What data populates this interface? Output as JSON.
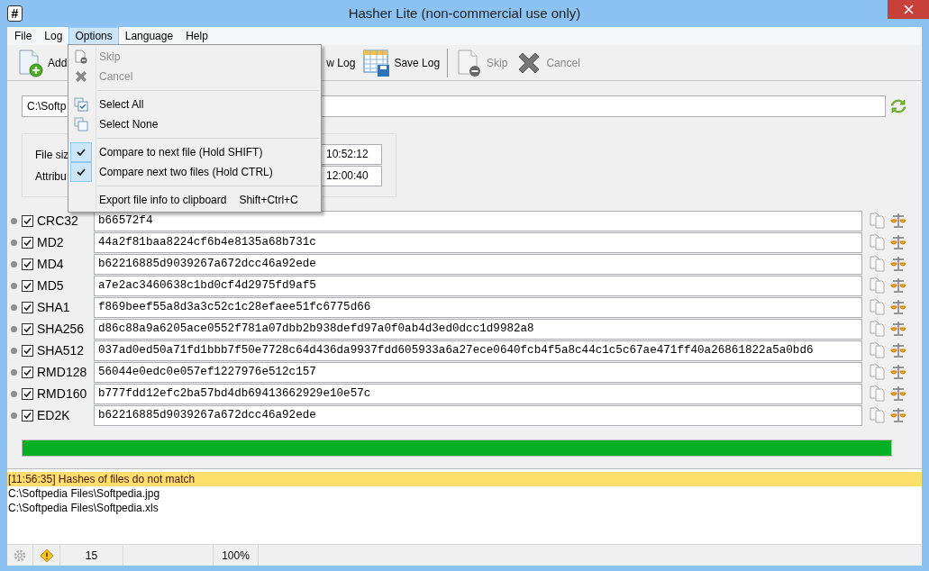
{
  "window": {
    "app_icon": "#",
    "title": "Hasher Lite (non-commercial use only)"
  },
  "menu_bar": [
    {
      "label": "File",
      "selected": false
    },
    {
      "label": "Log",
      "selected": false
    },
    {
      "label": "Options",
      "selected": true
    },
    {
      "label": "Language",
      "selected": false
    },
    {
      "label": "Help",
      "selected": false
    }
  ],
  "toolbar": [
    {
      "kind": "add",
      "label": "Add",
      "disabled": false
    },
    {
      "kind": "view",
      "label": "w Log",
      "disabled": false
    },
    {
      "kind": "save",
      "label": "Save Log",
      "disabled": false
    },
    {
      "kind": "sep"
    },
    {
      "kind": "skip",
      "label": "Skip",
      "disabled": true
    },
    {
      "kind": "cancel",
      "label": "Cancel",
      "disabled": true
    }
  ],
  "options_menu": [
    {
      "kind": "skip",
      "label": "Skip",
      "disabled": true
    },
    {
      "kind": "cancel",
      "label": "Cancel",
      "disabled": true
    },
    {
      "kind": "sep"
    },
    {
      "kind": "selall",
      "label": "Select All",
      "disabled": false
    },
    {
      "kind": "selnone",
      "label": "Select None",
      "disabled": false
    },
    {
      "kind": "sep"
    },
    {
      "kind": "check",
      "label": "Compare to next file (Hold SHIFT)",
      "checked": true,
      "disabled": false
    },
    {
      "kind": "check",
      "label": "Compare next two files (Hold CTRL)",
      "checked": true,
      "disabled": false
    },
    {
      "kind": "sep"
    },
    {
      "kind": "plain",
      "label": "Export file info to clipboard",
      "shortcut": "Shift+Ctrl+C",
      "disabled": false
    }
  ],
  "path_field": {
    "value": "C:\\Softp"
  },
  "file_info": [
    {
      "label": "File siz",
      "value": "10:52:12"
    },
    {
      "label": "Attribu",
      "value": "12:00:40"
    }
  ],
  "hashes": [
    {
      "name": "CRC32",
      "checked": true,
      "value": "b66572f4"
    },
    {
      "name": "MD2",
      "checked": true,
      "value": "44a2f81baa8224cf6b4e8135a68b731c"
    },
    {
      "name": "MD4",
      "checked": true,
      "value": "b62216885d9039267a672dcc46a92ede"
    },
    {
      "name": "MD5",
      "checked": true,
      "value": "a7e2ac3460638c1bd0cf4d2975fd9af5"
    },
    {
      "name": "SHA1",
      "checked": true,
      "value": "f869beef55a8d3a3c52c1c28efaee51fc6775d66"
    },
    {
      "name": "SHA256",
      "checked": true,
      "value": "d86c88a9a6205ace0552f781a07dbb2b938defd97a0f0ab4d3ed0dcc1d9982a8"
    },
    {
      "name": "SHA512",
      "checked": true,
      "value": "037ad0ed50a71fd1bbb7f50e7728c64d436da9937fdd605933a6a27ece0640fcb4f5a8c44c1c5c67ae471ff40a26861822a5a0bd6"
    },
    {
      "name": "RMD128",
      "checked": true,
      "value": "56044e0edc0e057ef1227976e512c157"
    },
    {
      "name": "RMD160",
      "checked": true,
      "value": "b777fdd12efc2ba57bd4db69413662929e10e57c"
    },
    {
      "name": "ED2K",
      "checked": true,
      "value": "b62216885d9039267a672dcc46a92ede"
    }
  ],
  "progress": {
    "level": 1.0
  },
  "log": [
    {
      "text": "[11:56:35] Hashes of files do not match",
      "highlighted": true
    },
    {
      "text": "C:\\Softpedia Files\\Softpedia.jpg",
      "highlighted": false
    },
    {
      "text": "C:\\Softpedia Files\\Softpedia.xls",
      "highlighted": false
    }
  ],
  "status_bar": {
    "count": "15",
    "percent": "100%"
  }
}
